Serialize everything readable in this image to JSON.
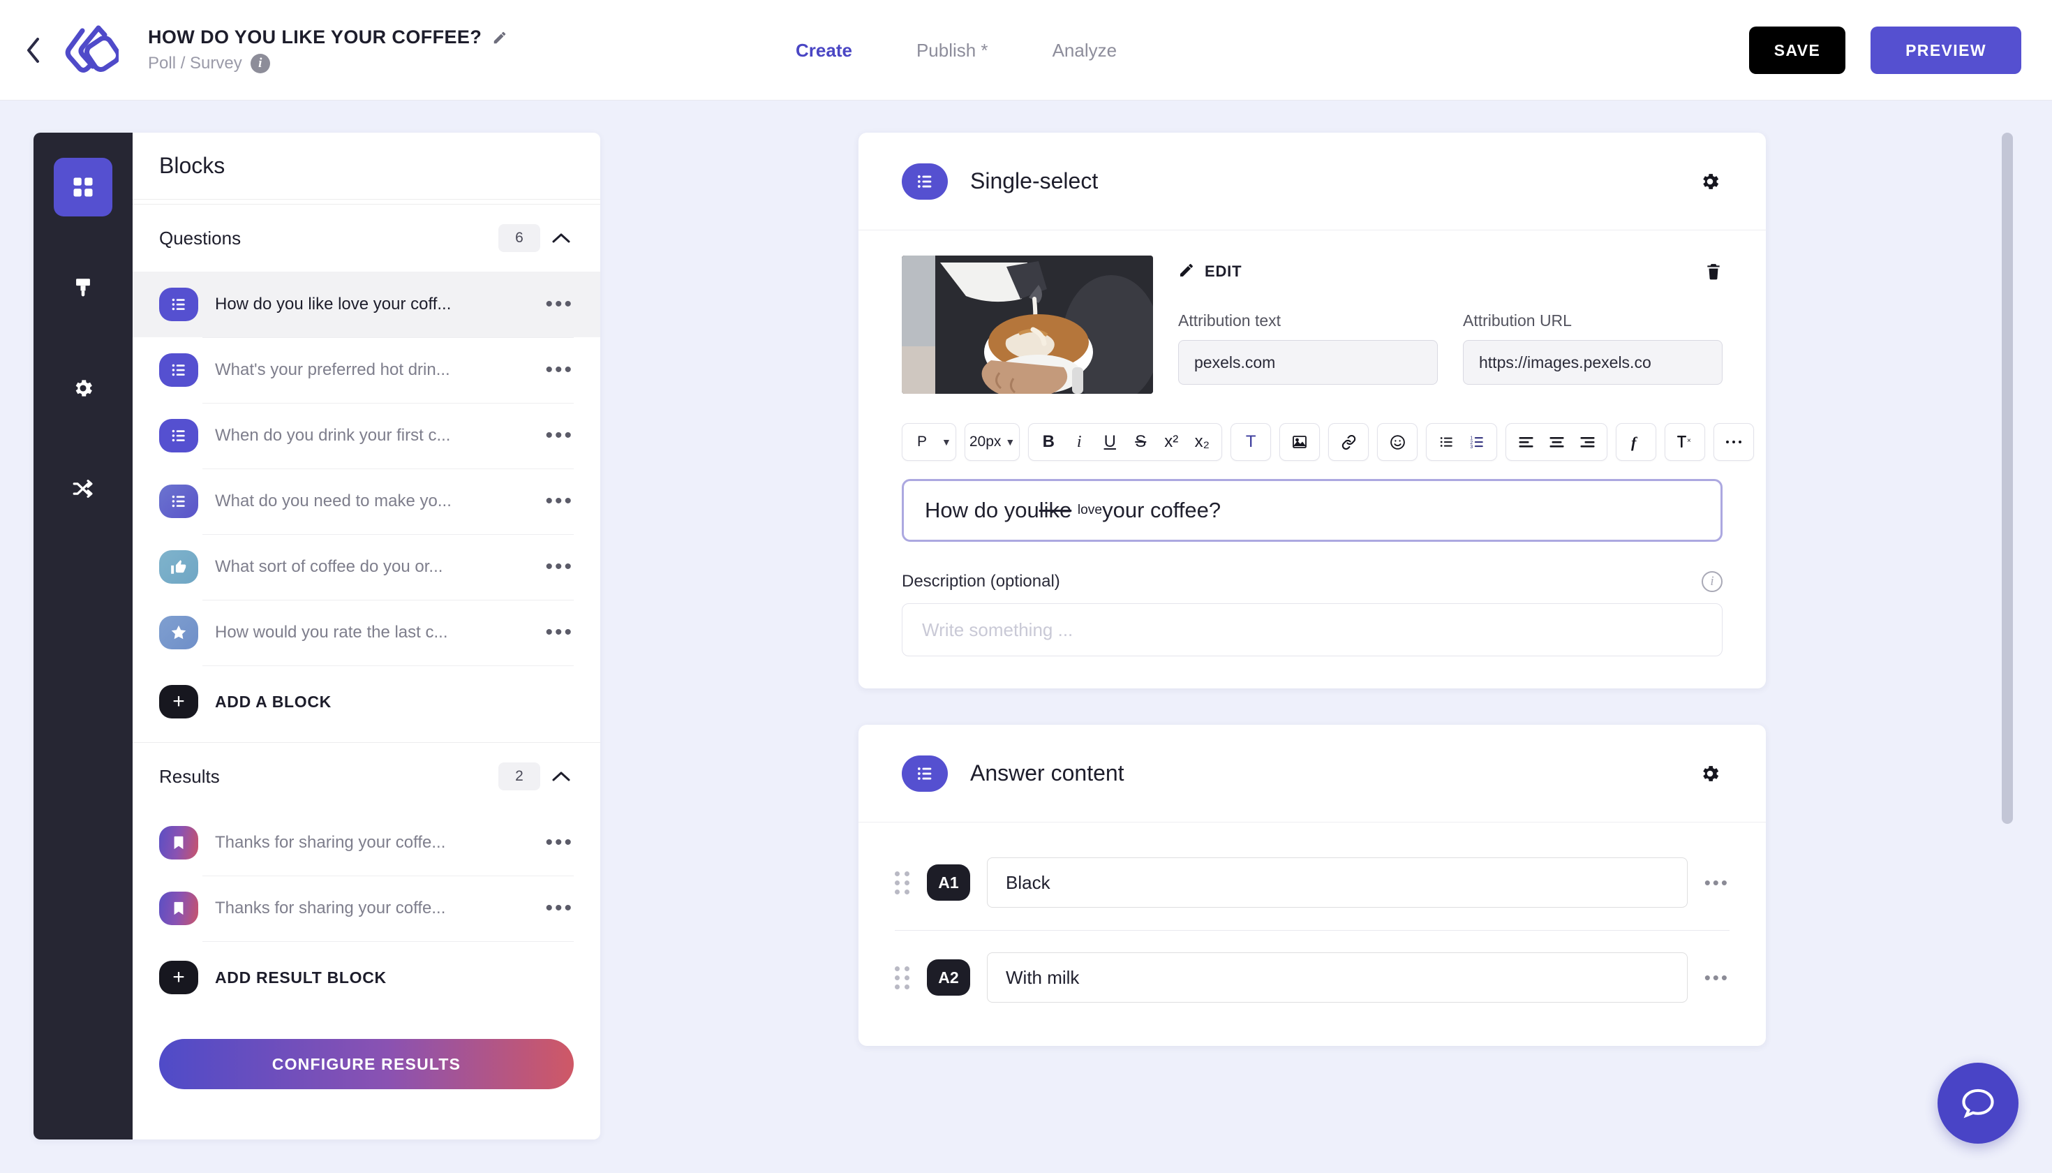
{
  "header": {
    "back_icon": "chevron-left-icon",
    "logo": "lunio-logo",
    "title": "HOW DO YOU LIKE YOUR COFFEE?",
    "edit_icon": "pencil-icon",
    "subtitle": "Poll / Survey",
    "info_icon": "info-icon",
    "nav": [
      {
        "label": "Create",
        "active": true
      },
      {
        "label": "Publish *",
        "active": false
      },
      {
        "label": "Analyze",
        "active": false
      }
    ],
    "save_label": "SAVE",
    "preview_label": "PREVIEW",
    "save_color": "#000000",
    "preview_color": "#5550d0"
  },
  "rail": {
    "items": [
      {
        "icon": "grid-blocks-icon",
        "active": true
      },
      {
        "icon": "paintbrush-icon",
        "active": false
      },
      {
        "icon": "gear-icon",
        "active": false
      },
      {
        "icon": "branch-share-icon",
        "active": false
      }
    ]
  },
  "blocks_panel": {
    "title": "Blocks",
    "questions": {
      "label": "Questions",
      "count": "6",
      "collapse_icon": "chevron-up-icon",
      "items": [
        {
          "label": "How do you like love your coff...",
          "icon": "single-select-icon",
          "selected": true
        },
        {
          "label": "What's your preferred hot drin...",
          "icon": "single-select-icon",
          "selected": false
        },
        {
          "label": "When do you drink your first c...",
          "icon": "single-select-icon",
          "selected": false
        },
        {
          "label": "What do you need to make yo...",
          "icon": "multi-select-icon",
          "selected": false
        },
        {
          "label": "What sort of coffee do you or...",
          "icon": "thumbs-up-icon",
          "selected": false
        },
        {
          "label": "How would you rate the last c...",
          "icon": "star-icon",
          "selected": false
        }
      ],
      "add_label": "ADD A BLOCK",
      "add_icon": "plus-icon"
    },
    "results": {
      "label": "Results",
      "count": "2",
      "collapse_icon": "chevron-up-icon",
      "items": [
        {
          "label": "Thanks for sharing your coffe...",
          "icon": "bookmark-icon"
        },
        {
          "label": "Thanks for sharing your coffe...",
          "icon": "bookmark-icon"
        }
      ],
      "add_label": "ADD RESULT BLOCK",
      "add_icon": "plus-icon"
    },
    "configure_label": "CONFIGURE RESULTS",
    "row_menu_icon": "ellipsis-icon"
  },
  "question_card": {
    "type_label": "Single-select",
    "type_icon": "single-select-icon",
    "settings_icon": "gear-icon",
    "image_alt": "barista pouring latte art into white cup",
    "edit_label": "EDIT",
    "edit_icon": "pencil-icon",
    "delete_icon": "trash-icon",
    "attribution_text_label": "Attribution text",
    "attribution_text_value": "pexels.com",
    "attribution_url_label": "Attribution URL",
    "attribution_url_value": "https://images.pexels.co",
    "toolbar": {
      "block_format": "P",
      "font_size": "20px",
      "bold": "B",
      "italic": "i",
      "underline": "U",
      "strikethrough": "S",
      "superscript": "x²",
      "subscript": "x₂",
      "text_color": "T",
      "image": "image-icon",
      "link": "link-icon",
      "emoji": "emoji-icon",
      "bullet_list": "bullet-list-icon",
      "numbered_list": "numbered-list-icon",
      "align_left": "align-left-icon",
      "align_center": "align-center-icon",
      "align_right": "align-right-icon",
      "formula": "formula-icon",
      "clear_format": "clear-format-icon",
      "more": "ellipsis-icon"
    },
    "question_prefix": "How do you ",
    "question_struck": "like",
    "question_super": "love",
    "question_suffix": " your coffee?",
    "description_label": "Description (optional)",
    "description_info_icon": "info-icon",
    "description_value": "",
    "description_placeholder": "Write something ..."
  },
  "answer_card": {
    "title": "Answer content",
    "title_icon": "single-select-icon",
    "settings_icon": "gear-icon",
    "rows": [
      {
        "badge": "A1",
        "value": "Black",
        "drag_icon": "drag-handle-icon",
        "menu_icon": "ellipsis-icon"
      },
      {
        "badge": "A2",
        "value": "With milk",
        "drag_icon": "drag-handle-icon",
        "menu_icon": "ellipsis-icon"
      }
    ]
  },
  "chat": {
    "icon": "chat-bubble-icon",
    "color": "#4944c6"
  },
  "scrollbar": {
    "icon": "vertical-scrollbar"
  }
}
